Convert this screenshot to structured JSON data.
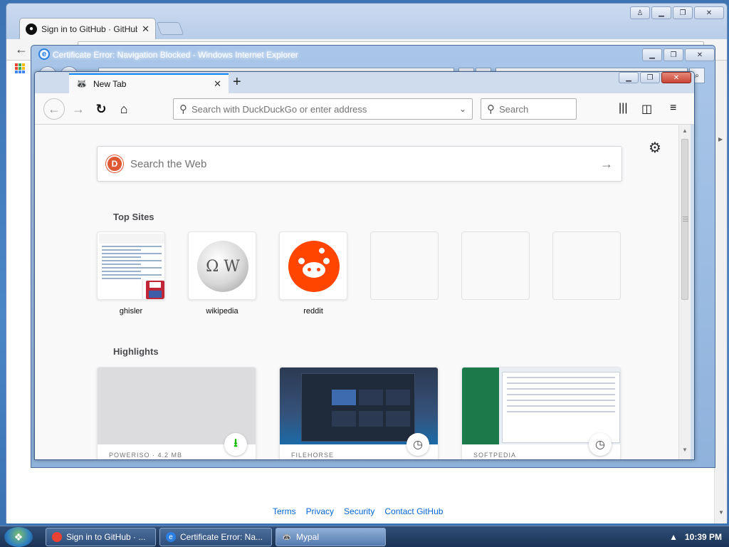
{
  "chrome": {
    "tab_title": "Sign in to GitHub · GitHub",
    "footer_links": [
      "Terms",
      "Privacy",
      "Security",
      "Contact GitHub"
    ]
  },
  "ie": {
    "title": "Certificate Error: Navigation Blocked - Windows Internet Explorer"
  },
  "firefox": {
    "tab_title": "New Tab",
    "urlbar_placeholder": "Search with DuckDuckGo or enter address",
    "searchbar_placeholder": "Search",
    "websearch_placeholder": "Search the Web",
    "top_sites_title": "Top Sites",
    "top_sites": [
      {
        "label": "ghisler"
      },
      {
        "label": "wikipedia"
      },
      {
        "label": "reddit"
      },
      {
        "label": ""
      },
      {
        "label": ""
      },
      {
        "label": ""
      }
    ],
    "highlights_title": "Highlights",
    "highlights": [
      {
        "meta": "POWERISO · 4.2 MB",
        "badge": "download"
      },
      {
        "meta": "FILEHORSE",
        "badge": "clock"
      },
      {
        "meta": "SOFTPEDIA",
        "badge": "clock"
      }
    ]
  },
  "taskbar": {
    "tasks": [
      {
        "label": "Sign in to GitHub · ..."
      },
      {
        "label": "Certificate Error: Na..."
      },
      {
        "label": "Mypal"
      }
    ],
    "clock": "10:39 PM"
  },
  "colors": {
    "firefox_accent": "#0a84ff",
    "reddit": "#ff4500",
    "duckduckgo": "#de5833",
    "download_green": "#12bc00",
    "github_link": "#0366d6"
  }
}
